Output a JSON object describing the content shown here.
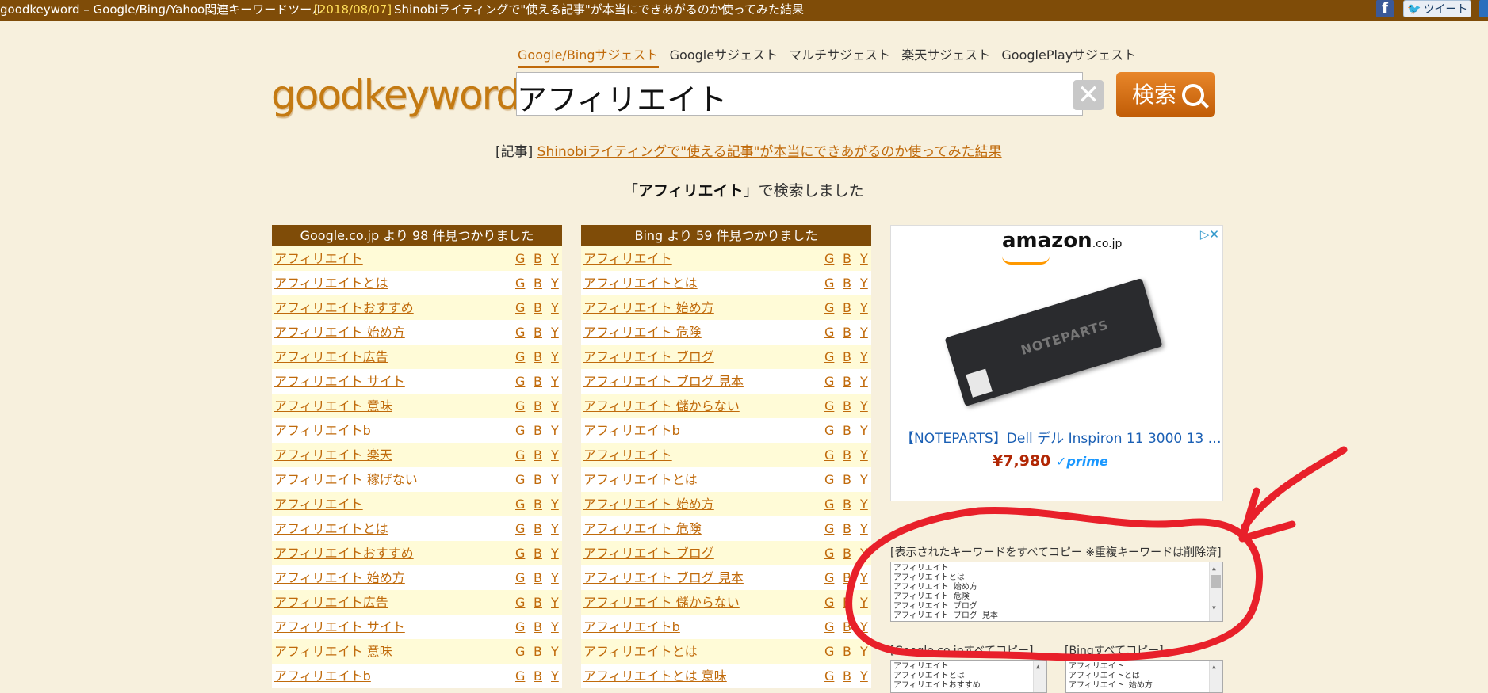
{
  "topbar": {
    "title": "goodkeyword – Google/Bing/Yahoo関連キーワードツール",
    "date": "[2018/08/07]",
    "news": "Shinobiライティングで\"使える記事\"が本当にできあがるのか使ってみた結果",
    "facebook_label": "f",
    "tweet_label": "ツイート"
  },
  "tabs": [
    "Google/Bingサジェスト",
    "Googleサジェスト",
    "マルチサジェスト",
    "楽天サジェスト",
    "GooglePlayサジェスト"
  ],
  "logo": "goodkeyword",
  "search": {
    "value": "アフィリエイト",
    "button_label": "検索",
    "clear_label": "✕"
  },
  "article": {
    "prefix": "[記事]",
    "link": "Shinobiライティングで\"使える記事\"が本当にできあがるのか使ってみた結果"
  },
  "result_message": {
    "open": "「",
    "keyword": "アフィリエイト",
    "close": "」で検索しました"
  },
  "google": {
    "header": "Google.co.jp より 98 件見つかりました",
    "rows": [
      "アフィリエイト",
      "アフィリエイトとは",
      "アフィリエイトおすすめ",
      "アフィリエイト 始め方",
      "アフィリエイト広告",
      "アフィリエイト サイト",
      "アフィリエイト 意味",
      "アフィリエイトb",
      "アフィリエイト 楽天",
      "アフィリエイト 稼げない",
      "アフィリエイト",
      "アフィリエイトとは",
      "アフィリエイトおすすめ",
      "アフィリエイト 始め方",
      "アフィリエイト広告",
      "アフィリエイト サイト",
      "アフィリエイト 意味",
      "アフィリエイトb"
    ]
  },
  "bing": {
    "header": "Bing より 59 件見つかりました",
    "rows": [
      "アフィリエイト",
      "アフィリエイトとは",
      "アフィリエイト 始め方",
      "アフィリエイト 危険",
      "アフィリエイト ブログ",
      "アフィリエイト ブログ 見本",
      "アフィリエイト 儲からない",
      "アフィリエイトb",
      "アフィリエイト",
      "アフィリエイトとは",
      "アフィリエイト 始め方",
      "アフィリエイト 危険",
      "アフィリエイト ブログ",
      "アフィリエイト ブログ 見本",
      "アフィリエイト 儲からない",
      "アフィリエイトb",
      "アフィリエイトとは",
      "アフィリエイトとは 意味"
    ]
  },
  "link_labels": {
    "g": "G",
    "b": "B",
    "y": "Y"
  },
  "ad": {
    "brand": "amazon",
    "domain": ".co.jp",
    "watermark": "NOTEPARTS",
    "title": "【NOTEPARTS】Dell デル Inspiron 11 3000 13 …",
    "price": "¥7,980",
    "prime": "✓prime",
    "icons": "▷✕"
  },
  "copy_all": {
    "label": "[表示されたキーワードをすべてコピー ※重複キーワードは削除済]",
    "lines": [
      "アフィリエイト",
      "アフィリエイトとは",
      "アフィリエイト 始め方",
      "アフィリエイト 危険",
      "アフィリエイト ブログ",
      "アフィリエイト ブログ 見本"
    ]
  },
  "copy_google": {
    "label": "[Google.co.jpすべてコピー]",
    "lines": [
      "アフィリエイト",
      "アフィリエイトとは",
      "アフィリエイトおすすめ"
    ]
  },
  "copy_bing": {
    "label": "[Bingすべてコピー]",
    "lines": [
      "アフィリエイト",
      "アフィリエイトとは",
      "アフィリエイト 始め方"
    ]
  },
  "colors": {
    "topbar": "#7f4c08",
    "accent": "#c06a0b",
    "row_alt": "#fffbd7",
    "annotation": "#e8202a"
  }
}
